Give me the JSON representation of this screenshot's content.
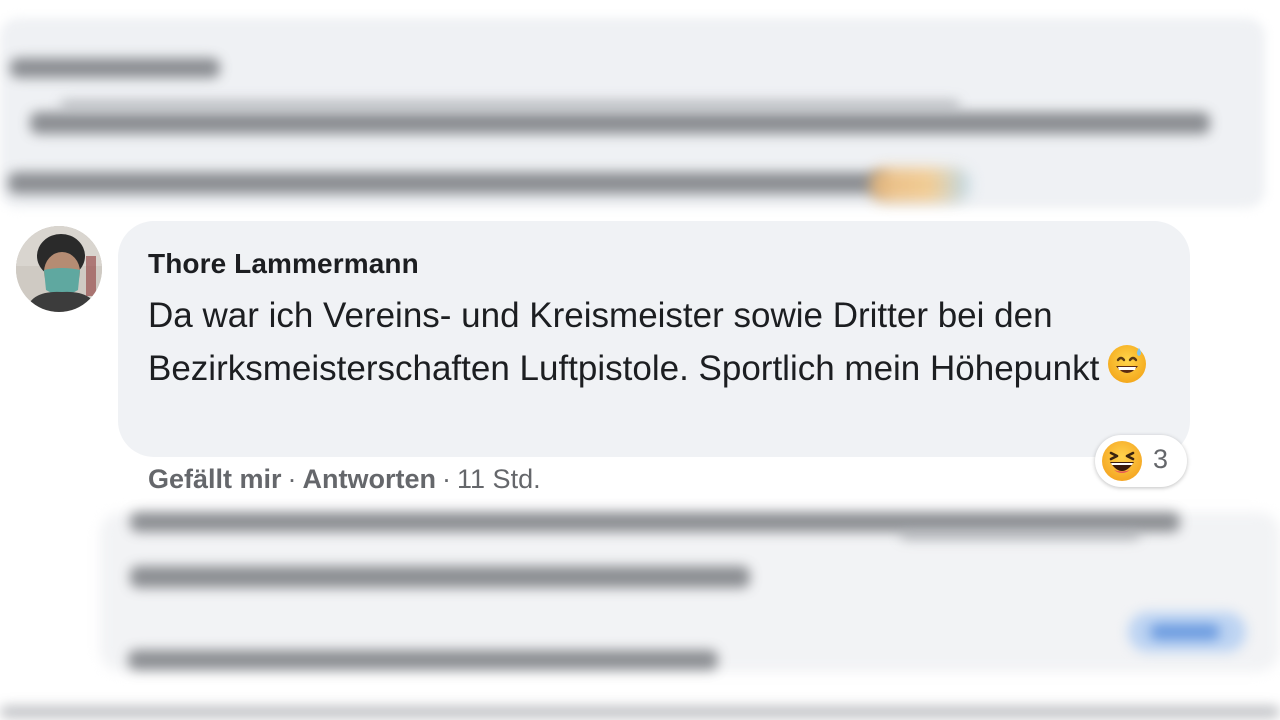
{
  "comment": {
    "author": "Thore Lammermann",
    "text": "Da war ich Vereins- und Kreismeister sowie Dritter bei den Bezirksmeisterschaften Luftpistole. Sportlich mein Höhepunkt",
    "emoji": "grinning-face-with-sweat-icon",
    "reaction": {
      "icon": "laughing-face-icon",
      "count": "3"
    },
    "actions": {
      "like": "Gefällt mir",
      "separator": "·",
      "reply": "Antworten",
      "time": "11 Std."
    }
  },
  "colors": {
    "bubble": "#f0f2f5",
    "text": "#1c1e21",
    "secondary_text": "#65676b",
    "reaction_yellow": "#f7b125"
  }
}
